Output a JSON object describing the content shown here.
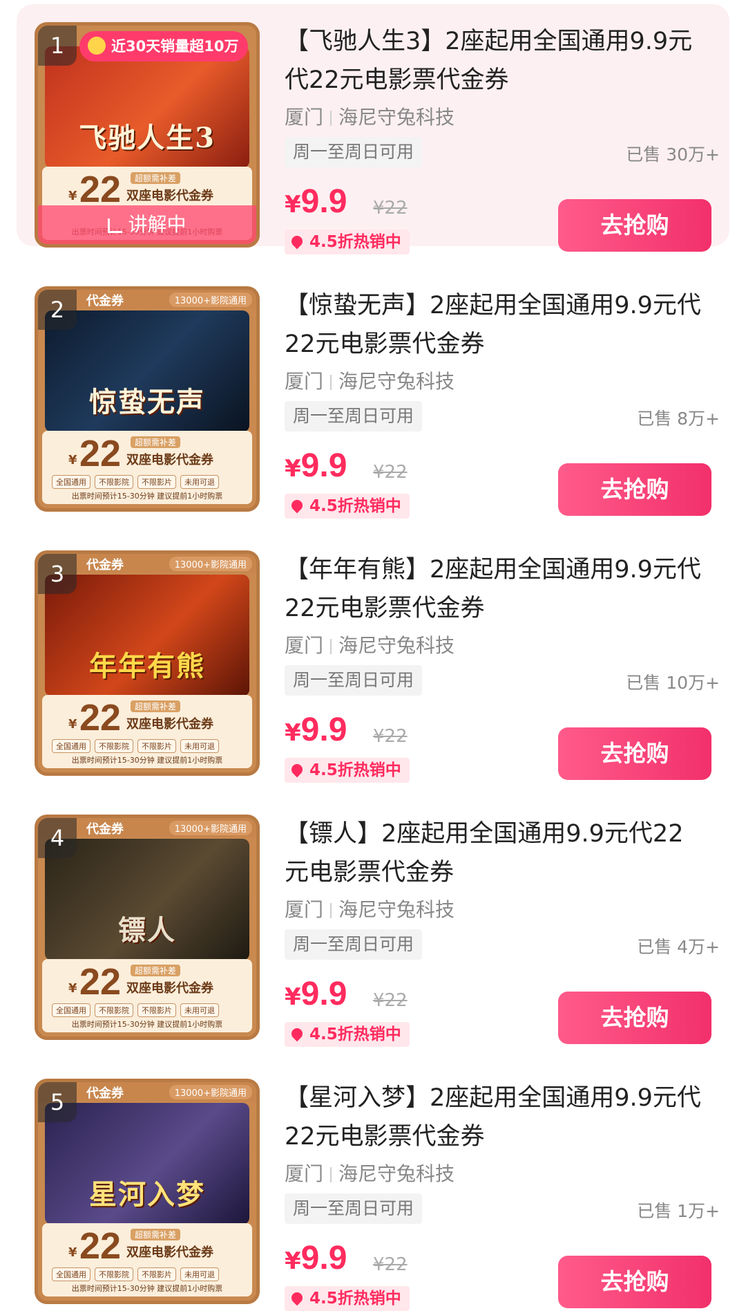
{
  "colors": {
    "accent": "#ff2b5e",
    "button": "#f2306b",
    "active_bg": "#fdf0f2"
  },
  "voucher": {
    "tag_label": "代金券",
    "cinemas": "13000+影院通用",
    "yen": "¥",
    "amount": "22",
    "subsidy": "超额需补差",
    "title": "双座电影代金券",
    "pills": [
      "全国通用",
      "不限影院",
      "不限影片",
      "未用可退"
    ],
    "foot": "出票时间预计15-30分钟 建议提前1小时购票"
  },
  "products": [
    {
      "rank": "1",
      "hot_badge": "近30天销量超10万",
      "explaining": "讲解中",
      "poster_title": "飞驰人生3",
      "title": "【飞驰人生3】2座起用全国通用9.9元代22元电影票代金券",
      "city": "厦门",
      "shop": "海尼守兔科技",
      "availability": "周一至周日可用",
      "sold": "已售 30万+",
      "currency": "¥",
      "price": "9.9",
      "original_price": "¥22",
      "discount": "4.5折热销中",
      "buy_label": "去抢购"
    },
    {
      "rank": "2",
      "poster_title": "惊蛰无声",
      "title": "【惊蛰无声】2座起用全国通用9.9元代22元电影票代金券",
      "city": "厦门",
      "shop": "海尼守兔科技",
      "availability": "周一至周日可用",
      "sold": "已售 8万+",
      "currency": "¥",
      "price": "9.9",
      "original_price": "¥22",
      "discount": "4.5折热销中",
      "buy_label": "去抢购"
    },
    {
      "rank": "3",
      "poster_title": "年年有熊",
      "title": "【年年有熊】2座起用全国通用9.9元代22元电影票代金券",
      "city": "厦门",
      "shop": "海尼守兔科技",
      "availability": "周一至周日可用",
      "sold": "已售 10万+",
      "currency": "¥",
      "price": "9.9",
      "original_price": "¥22",
      "discount": "4.5折热销中",
      "buy_label": "去抢购"
    },
    {
      "rank": "4",
      "poster_title": "镖人",
      "title": "【镖人】2座起用全国通用9.9元代22元电影票代金券",
      "city": "厦门",
      "shop": "海尼守兔科技",
      "availability": "周一至周日可用",
      "sold": "已售 4万+",
      "currency": "¥",
      "price": "9.9",
      "original_price": "¥22",
      "discount": "4.5折热销中",
      "buy_label": "去抢购"
    },
    {
      "rank": "5",
      "poster_title": "星河入梦",
      "title": "【星河入梦】2座起用全国通用9.9元代22元电影票代金券",
      "city": "厦门",
      "shop": "海尼守兔科技",
      "availability": "周一至周日可用",
      "sold": "已售 1万+",
      "currency": "¥",
      "price": "9.9",
      "original_price": "¥22",
      "discount": "4.5折热销中",
      "buy_label": "去抢购"
    }
  ]
}
